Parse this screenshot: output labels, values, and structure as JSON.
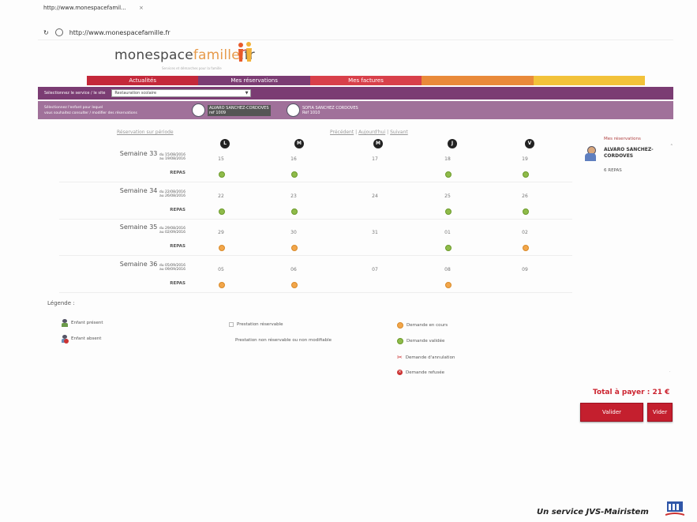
{
  "browser": {
    "tab_label": "http://www.monespacefamil...",
    "tab_close": "×",
    "url": "http://www.monespacefamille.fr"
  },
  "header": {
    "logo_main": "monespace",
    "logo_accent": "famille",
    "logo_tld": ".fr",
    "tagline": "Services et démarches pour la famille"
  },
  "nav": {
    "items": [
      {
        "label": "Actualités",
        "color": "#c4283a"
      },
      {
        "label": "Mes réservations",
        "color": "#7b3c73"
      },
      {
        "label": "Mes factures",
        "color": "#d8404a"
      },
      {
        "label": "",
        "color": "#e98a3a"
      },
      {
        "label": "",
        "color": "#f2c23a"
      }
    ]
  },
  "service_bar": {
    "label": "Sélectionnez le service / le site",
    "selected": "Restauration scolaire",
    "arrow": "▼"
  },
  "children_bar": {
    "text_line1": "Sélectionnez l'enfant pour lequel",
    "text_line2": "vous souhaitez consulter / modifier des réservations",
    "children": [
      {
        "name": "ALVARO SANCHEZ-CORDOVES",
        "sub": "ref 1009"
      },
      {
        "name": "SOFIA SANCHEZ CORDOVES",
        "sub": "Réf 1010"
      }
    ]
  },
  "calendar": {
    "prev_period": "Réservation sur période",
    "nav_prev": "Précédent",
    "nav_today": "Aujourd'hui",
    "nav_next": "Suivant",
    "sep": "|",
    "days": [
      "L",
      "M",
      "M",
      "J",
      "V"
    ],
    "meal_label": "REPAS",
    "weeks": [
      {
        "label": "Semaine 33",
        "from": "du 15/08/2016",
        "to": "au 19/08/2016",
        "dates": [
          "15",
          "16",
          "17",
          "18",
          "19"
        ],
        "meals": [
          "valid",
          "valid",
          "",
          "valid",
          "valid"
        ]
      },
      {
        "label": "Semaine 34",
        "from": "du 22/08/2016",
        "to": "au 26/08/2016",
        "dates": [
          "22",
          "23",
          "24",
          "25",
          "26"
        ],
        "meals": [
          "valid",
          "valid",
          "",
          "valid",
          "valid"
        ]
      },
      {
        "label": "Semaine 35",
        "from": "du 29/08/2016",
        "to": "au 02/09/2016",
        "dates": [
          "29",
          "30",
          "31",
          "01",
          "02"
        ],
        "meals": [
          "pending",
          "pending",
          "",
          "valid",
          "pending"
        ]
      },
      {
        "label": "Semaine 36",
        "from": "du 05/09/2016",
        "to": "au 09/09/2016",
        "dates": [
          "05",
          "06",
          "07",
          "08",
          "09"
        ],
        "meals": [
          "pending",
          "pending",
          "",
          "pending",
          ""
        ]
      }
    ]
  },
  "legend": {
    "title": "Légende :",
    "present": "Enfant présent",
    "absent": "Enfant absent",
    "bookable": "Prestation réservable",
    "not_bookable": "Prestation non réservable ou non modifiable",
    "pending": "Demande en cours",
    "validated": "Demande validée",
    "cancel": "Demande d'annulation",
    "refused": "Demande refusée"
  },
  "sidebar": {
    "title": "Mes réservations",
    "child_name_1": "ALVARO SANCHEZ-",
    "child_name_2": "CORDOVES",
    "meals": "6 REPAS",
    "total": "Total à payer : 21 €",
    "validate_label": "Valider",
    "clear_label": "Vider"
  },
  "footer": {
    "text": "Un service JVS-Mairistem"
  }
}
